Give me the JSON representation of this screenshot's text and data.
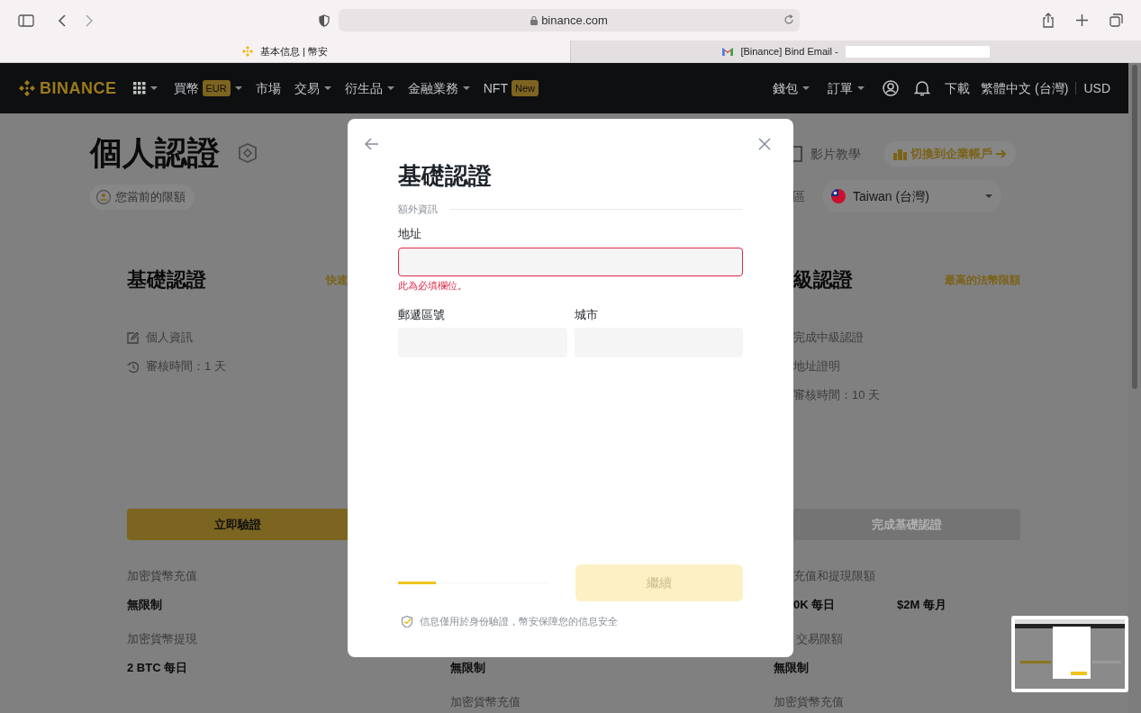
{
  "browser": {
    "address": "binance.com",
    "tabs": [
      {
        "title": "基本信息 | 幣安",
        "selected": true,
        "kind": "binance"
      },
      {
        "title": "[Binance] Bind Email -",
        "selected": false,
        "kind": "mail"
      }
    ]
  },
  "navbar": {
    "logo": "BINANCE",
    "menu": [
      {
        "label": "買幣",
        "badge": "EUR",
        "dropdown": true
      },
      {
        "label": "市場",
        "dropdown": false
      },
      {
        "label": "交易",
        "dropdown": true
      },
      {
        "label": "衍生品",
        "dropdown": true
      },
      {
        "label": "金融業務",
        "dropdown": true
      },
      {
        "label": "NFT",
        "badge": "New",
        "dropdown": false
      }
    ],
    "right_menu": [
      {
        "label": "錢包",
        "dropdown": true
      },
      {
        "label": "訂單",
        "dropdown": true
      }
    ],
    "download": "下載",
    "language": "繁體中文 (台灣)",
    "currency": "USD"
  },
  "page": {
    "title": "個人認證",
    "limits_pill": "您當前的限額",
    "video_tutorial": "影片教學",
    "business_button": "切換到企業帳戶",
    "region_label": "區",
    "region": "Taiwan (台灣)"
  },
  "cards": [
    {
      "title": "基礎認證",
      "tag": "快速",
      "items": [
        {
          "kind": "edit",
          "text": "個人資訊"
        },
        {
          "kind": "clock",
          "text": "審核時間：1 天"
        }
      ],
      "button": {
        "label": "立即驗證",
        "disabled": false
      },
      "limits": [
        {
          "label": "加密貨幣充值",
          "values": [
            "無限制"
          ]
        },
        {
          "label": "加密貨幣提現",
          "values": [
            "2 BTC 每日"
          ]
        }
      ]
    },
    {
      "limits": [
        {
          "values": [
            "無限制"
          ]
        },
        {
          "label": "加密貨幣充值"
        }
      ]
    },
    {
      "title": "級認證",
      "tag": "最高的法幣限額",
      "items": [
        {
          "kind": "plain",
          "text": "完成中級認證"
        },
        {
          "kind": "plain",
          "text": "地址證明"
        },
        {
          "kind": "plain",
          "text": "審核時間：10 天"
        }
      ],
      "button": {
        "label": "完成基礎認證",
        "disabled": true
      },
      "limits": [
        {
          "label": "充值和提現限額",
          "values": [
            "0K 每日",
            "$2M 每月"
          ]
        },
        {
          "label": "交易限額",
          "values": [
            "無限制"
          ]
        },
        {
          "label": "加密貨幣充值"
        }
      ]
    }
  ],
  "modal": {
    "title": "基礎認證",
    "section": "額外資訊",
    "address": {
      "label": "地址",
      "error": "此為必填欄位。"
    },
    "postal_code": {
      "label": "郵遞區號"
    },
    "city": {
      "label": "城市"
    },
    "step_progress": {
      "level": 0.25
    },
    "continue_button": {
      "label": "繼續",
      "disabled": true
    },
    "notice": "信息僅用於身份驗證，幣安保障您的信息安全"
  }
}
